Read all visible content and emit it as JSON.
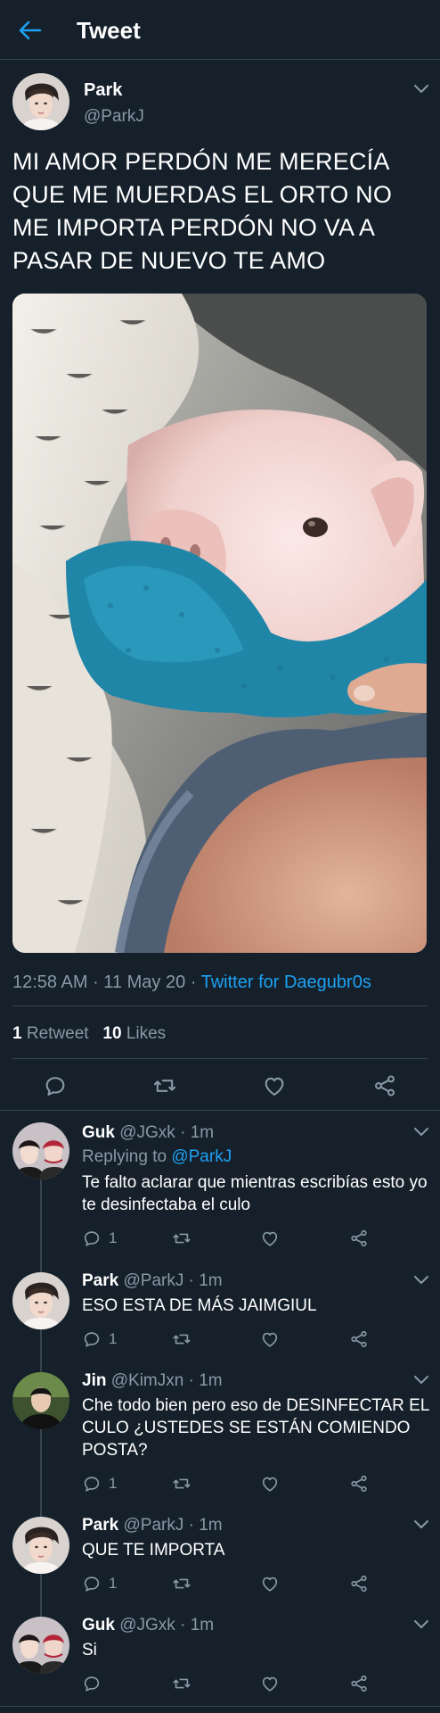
{
  "header": {
    "title": "Tweet"
  },
  "tweet": {
    "name": "Park",
    "handle": "@ParkJ",
    "text": "MI AMOR PERDÓN ME MERECÍA QUE ME MUERDAS EL ORTO NO ME IMPORTA PERDÓN NO VA A PASAR DE NUEVO TE AMO",
    "time": "12:58 AM",
    "date": "11 May 20",
    "source": "Twitter for Daegubr0s",
    "retweets": "1",
    "retweets_label": "Retweet",
    "likes": "10",
    "likes_label": "Likes"
  },
  "replies": [
    {
      "name": "Guk",
      "handle": "@JGxk",
      "age": "1m",
      "replying_prefix": "Replying to",
      "replying_to": "@ParkJ",
      "text": "Te falto aclarar que mientras escribías esto yo te desinfectaba el culo",
      "reply_count": "1"
    },
    {
      "name": "Park",
      "handle": "@ParkJ",
      "age": "1m",
      "text": "ESO ESTA DE MÁS JAIMGIUL",
      "reply_count": "1"
    },
    {
      "name": "Jin",
      "handle": "@KimJxn",
      "age": "1m",
      "text": "Che todo bien pero eso de DESINFECTAR EL CULO ¿USTEDES SE ESTÁN COMIENDO POSTA?",
      "reply_count": "1"
    },
    {
      "name": "Park",
      "handle": "@ParkJ",
      "age": "1m",
      "text": "QUE TE IMPORTA",
      "reply_count": "1"
    },
    {
      "name": "Guk",
      "handle": "@JGxk",
      "age": "1m",
      "text": "Si",
      "reply_count": ""
    }
  ],
  "separator": " · ",
  "colors": {
    "background": "#15202b",
    "accent": "#1da1f2",
    "muted": "#8899a6",
    "divider": "#38444d"
  }
}
